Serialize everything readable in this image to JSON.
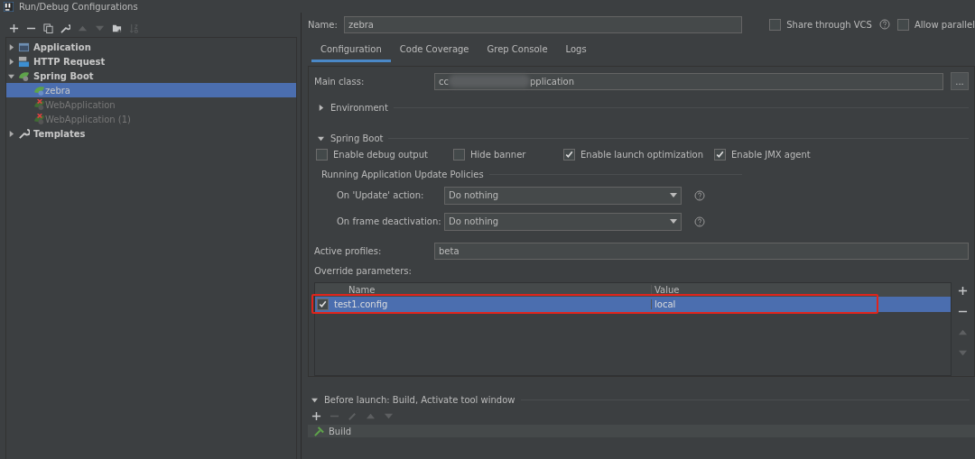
{
  "window": {
    "title": "Run/Debug Configurations"
  },
  "toolbar": [
    {
      "kind": "add",
      "disabled": false
    },
    {
      "kind": "remove",
      "disabled": false
    },
    {
      "kind": "copy",
      "disabled": false
    },
    {
      "kind": "edit",
      "disabled": false
    },
    {
      "kind": "up",
      "disabled": true
    },
    {
      "kind": "down",
      "disabled": true
    },
    {
      "kind": "folder",
      "disabled": false
    },
    {
      "kind": "sort",
      "disabled": true
    }
  ],
  "tree": [
    {
      "label": "Application",
      "kind": "app",
      "expanded": false,
      "selected": false
    },
    {
      "label": "HTTP Request",
      "kind": "http",
      "expanded": false,
      "selected": false
    },
    {
      "label": "Spring Boot",
      "kind": "spring",
      "expanded": true,
      "selected": false,
      "children": [
        {
          "label": "zebra",
          "selected": true,
          "error": false
        },
        {
          "label": "WebApplication",
          "selected": false,
          "error": true
        },
        {
          "label": "WebApplication (1)",
          "selected": false,
          "error": true
        }
      ]
    },
    {
      "label": "Templates",
      "kind": "templates",
      "expanded": false,
      "selected": false
    }
  ],
  "name": {
    "label": "Name:",
    "value": "zebra"
  },
  "options": [
    {
      "label": "Share through VCS",
      "checked": false,
      "help": true
    },
    {
      "label": "Allow parallel",
      "checked": false,
      "help": false
    }
  ],
  "tabs": [
    {
      "label": "Configuration",
      "selected": true
    },
    {
      "label": "Code Coverage",
      "selected": false
    },
    {
      "label": "Grep Console",
      "selected": false
    },
    {
      "label": "Logs",
      "selected": false
    }
  ],
  "main_class": {
    "label": "Main class:",
    "value_start": "cc",
    "value_end": "pplication",
    "redacted": true,
    "browse": "..."
  },
  "environment": {
    "label": "Environment",
    "expanded": false
  },
  "spring_boot": {
    "label": "Spring Boot",
    "expanded": true,
    "checkboxes": [
      {
        "label": "Enable debug output",
        "checked": false
      },
      {
        "label": "Hide banner",
        "checked": false
      },
      {
        "label": "Enable launch optimization",
        "checked": true
      },
      {
        "label": "Enable JMX agent",
        "checked": true
      }
    ],
    "policies": {
      "title": "Running Application Update Policies",
      "rows": [
        {
          "label": "On 'Update' action:",
          "value": "Do nothing"
        },
        {
          "label": "On frame deactivation:",
          "value": "Do nothing"
        }
      ]
    }
  },
  "active_profiles": {
    "label": "Active profiles:",
    "value": "beta"
  },
  "override": {
    "label": "Override parameters:",
    "columns": [
      "Name",
      "Value"
    ],
    "rows": [
      {
        "checked": true,
        "name": "test1.config",
        "value": "local",
        "selected": true,
        "highlighted": true
      }
    ],
    "side_buttons": [
      {
        "kind": "add",
        "disabled": false
      },
      {
        "kind": "remove",
        "disabled": false
      },
      {
        "kind": "up",
        "disabled": true
      },
      {
        "kind": "down",
        "disabled": true
      }
    ]
  },
  "before_launch": {
    "label": "Before launch: Build, Activate tool window",
    "expanded": true,
    "toolbar": [
      {
        "kind": "add",
        "disabled": false
      },
      {
        "kind": "remove",
        "disabled": true
      },
      {
        "kind": "edit",
        "disabled": true
      },
      {
        "kind": "up",
        "disabled": true
      },
      {
        "kind": "down",
        "disabled": true
      }
    ],
    "items": [
      {
        "label": "Build"
      }
    ]
  }
}
